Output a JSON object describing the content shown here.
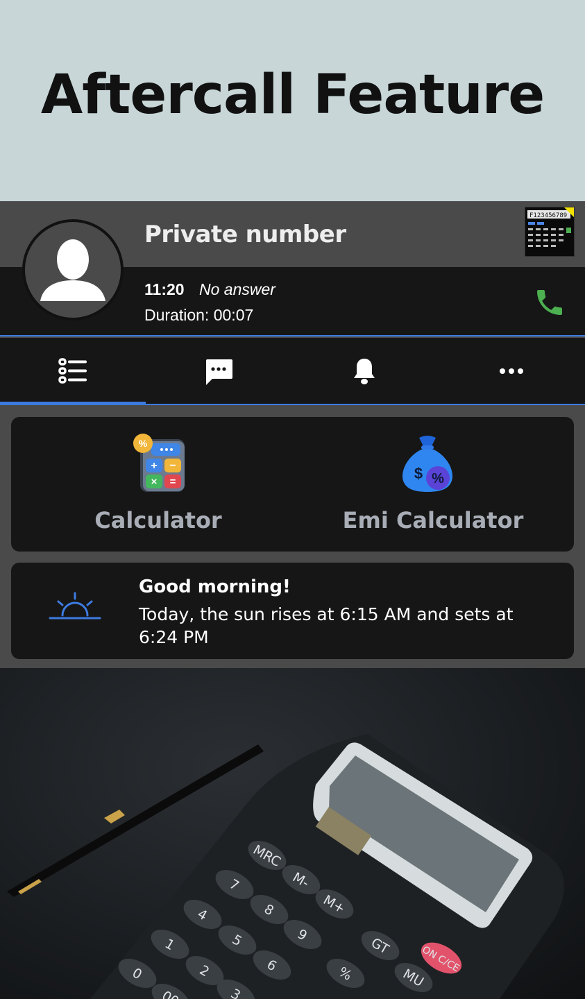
{
  "hero": {
    "title": "Aftercall Feature"
  },
  "caller": {
    "name": "Private number",
    "time": "11:20",
    "status": "No answer",
    "duration": "Duration: 00:07"
  },
  "tabs": [
    {
      "icon": "list-icon",
      "active": true
    },
    {
      "icon": "message-icon",
      "active": false
    },
    {
      "icon": "bell-icon",
      "active": false
    },
    {
      "icon": "more-icon",
      "active": false
    }
  ],
  "tools": [
    {
      "label": "Calculator",
      "icon": "calculator-icon"
    },
    {
      "label": "Emi Calculator",
      "icon": "money-bag-icon"
    }
  ],
  "greeting": {
    "title": "Good morning!",
    "text": "Today, the sun rises at 6:15 AM and sets at 6:24 PM"
  },
  "colors": {
    "accent": "#3d7be0",
    "phone": "#4caf50",
    "panel": "#161616",
    "header": "#4a4a4a"
  },
  "photo": {
    "keys": [
      "MRC",
      "M-",
      "M+",
      "7",
      "8",
      "9",
      "4",
      "5",
      "6",
      "1",
      "2",
      "3",
      "0",
      "00",
      "GT",
      "%",
      "ON C/CE",
      "MU"
    ]
  }
}
